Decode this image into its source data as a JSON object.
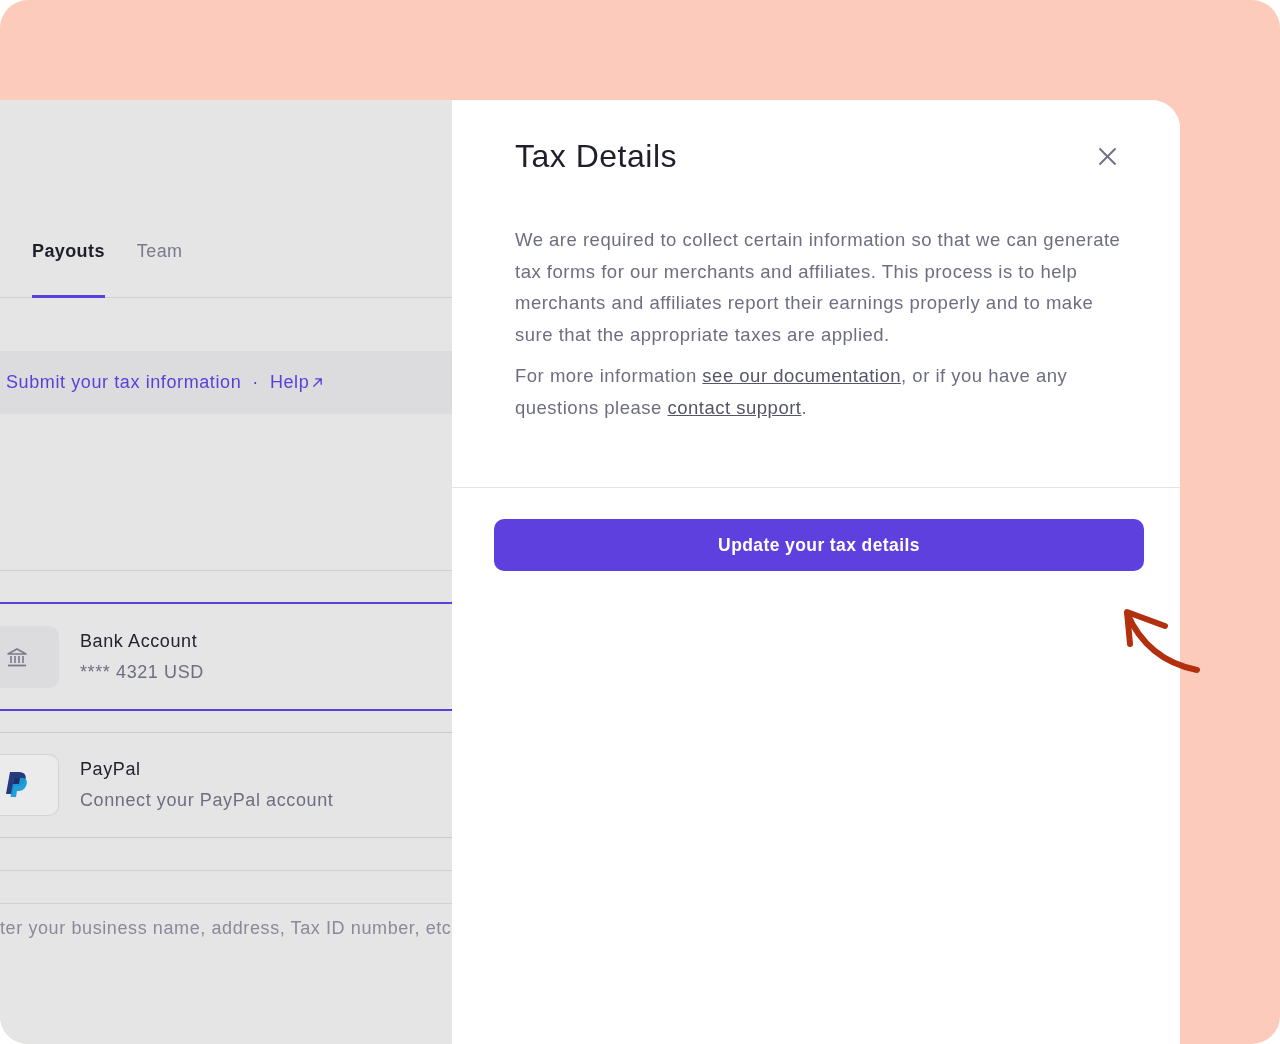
{
  "background_page": {
    "tabs": [
      {
        "label": "Payouts",
        "selected": true
      },
      {
        "label": "Team",
        "selected": false
      }
    ],
    "notice": {
      "link": "Submit your tax information",
      "separator": "·",
      "help_link": "Help"
    },
    "payout_methods": [
      {
        "kind": "bank",
        "title": "Bank Account",
        "subtitle": "**** 4321 USD",
        "selected": true
      },
      {
        "kind": "paypal",
        "title": "PayPal",
        "subtitle": "Connect your PayPal account",
        "selected": false
      }
    ],
    "description": "ter your business name, address, Tax ID number, etc"
  },
  "drawer": {
    "title": "Tax Details",
    "intro": "We are required to collect certain information so that we can generate tax forms for our merchants and affiliates. This process is to help merchants and affiliates report their earnings properly and to make sure that the appropriate taxes are applied.",
    "more_info": [
      {
        "kind": "text",
        "text": "For more information "
      },
      {
        "kind": "link",
        "text": "see our documentation"
      },
      {
        "kind": "text",
        "text": ", or if you have any questions please "
      },
      {
        "kind": "link",
        "text": "contact support"
      },
      {
        "kind": "text",
        "text": "."
      }
    ],
    "button": "Update your tax details"
  }
}
